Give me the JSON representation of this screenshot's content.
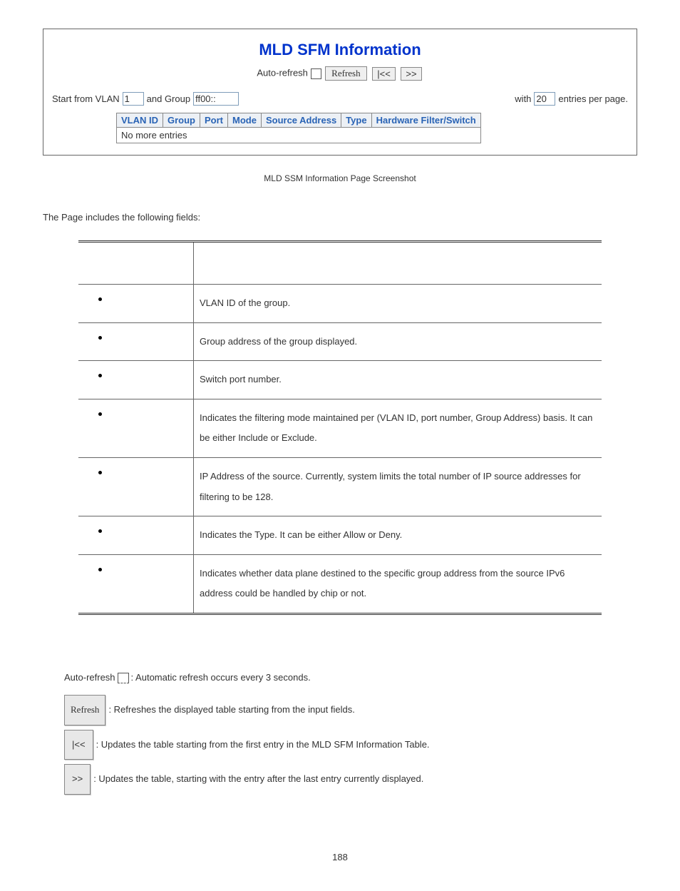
{
  "screenshot": {
    "title": "MLD SFM Information",
    "auto_refresh_label": "Auto-refresh",
    "refresh_btn": "Refresh",
    "first_btn": "|<<",
    "next_btn": ">>",
    "start_label": "Start from VLAN",
    "vlan_value": "1",
    "group_label": "and Group",
    "group_value": "ff00::",
    "with_label": "with",
    "perpage_value": "20",
    "perpage_label": "entries per page.",
    "columns": [
      "VLAN ID",
      "Group",
      "Port",
      "Mode",
      "Source Address",
      "Type",
      "Hardware Filter/Switch"
    ],
    "no_entries": "No more entries"
  },
  "caption": "MLD SSM Information Page Screenshot",
  "fields_intro": "The Page includes the following fields:",
  "fields": [
    {
      "desc": "VLAN ID of the group."
    },
    {
      "desc": "Group address of the group displayed."
    },
    {
      "desc": "Switch port number."
    },
    {
      "desc": "Indicates the filtering mode maintained per (VLAN ID, port number, Group Address) basis. It can be either Include or Exclude."
    },
    {
      "desc": "IP Address of the source. Currently, system limits the total number of IP source addresses for filtering to be 128."
    },
    {
      "desc": "Indicates the Type. It can be either Allow or Deny."
    },
    {
      "desc": "Indicates whether data plane destined to the specific group address from the source IPv6 address could be handled by chip or not."
    }
  ],
  "buttons_desc": {
    "auto_refresh_prefix": "Auto-refresh",
    "auto_refresh": ": Automatic refresh occurs every 3 seconds.",
    "refresh_btn": "Refresh",
    "refresh": ": Refreshes the displayed table starting from the input fields.",
    "first_btn": "|<<",
    "first": ": Updates the table starting from the first entry in the MLD SFM Information Table.",
    "next_btn": ">>",
    "next": ": Updates the table, starting with the entry after the last entry currently displayed."
  },
  "page_number": "188"
}
